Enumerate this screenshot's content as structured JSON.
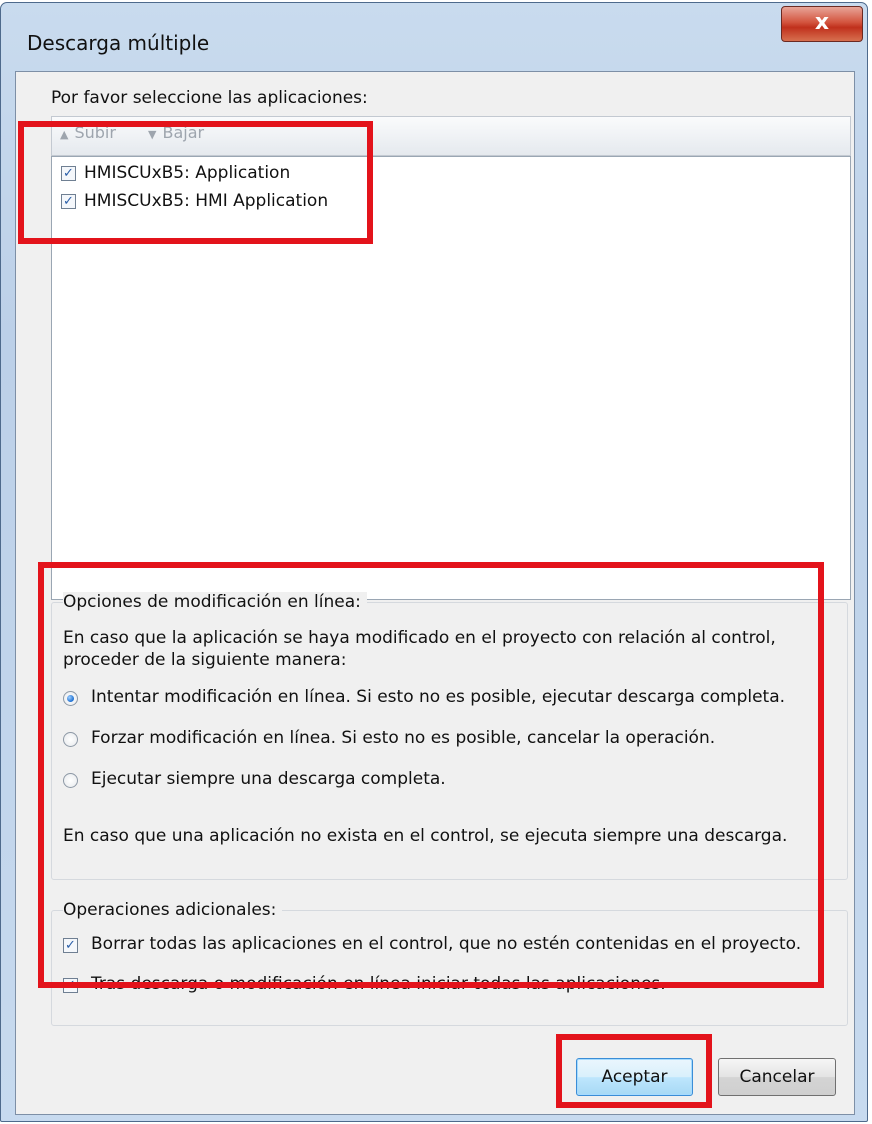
{
  "window": {
    "title": "Descarga múltiple",
    "close_icon": "close-icon",
    "close_glyph": "x"
  },
  "apps_section": {
    "label": "Por favor seleccione las aplicaciones:",
    "toolbar": {
      "up_label": "Subir",
      "down_label": "Bajar",
      "up_icon": "arrow-up-icon",
      "down_icon": "arrow-down-icon"
    },
    "items": [
      {
        "label": "HMISCUxB5:  Application",
        "checked": true
      },
      {
        "label": "HMISCUxB5:  HMI Application",
        "checked": true
      }
    ]
  },
  "online_options": {
    "legend": "Opciones de modificación en línea:",
    "description_line1": "En caso que la aplicación se haya modificado en el proyecto con relación al control,",
    "description_line2": "proceder de la siguiente manera:",
    "options": [
      {
        "label": "Intentar modificación en línea. Si esto no es posible, ejecutar descarga completa.",
        "selected": true
      },
      {
        "label": "Forzar modificación en línea. Si esto no es posible, cancelar la operación.",
        "selected": false
      },
      {
        "label": "Ejecutar siempre una descarga completa.",
        "selected": false
      }
    ],
    "note": "En caso que una aplicación no exista en el control, se ejecuta siempre una descarga."
  },
  "additional_ops": {
    "legend": "Operaciones adicionales:",
    "items": [
      {
        "label": "Borrar todas las aplicaciones en el control, que no estén contenidas en el proyecto.",
        "checked": true
      },
      {
        "label": "Tras descarga o modificación en línea iniciar todas las aplicaciones.",
        "checked": true
      }
    ]
  },
  "buttons": {
    "accept": "Aceptar",
    "cancel": "Cancelar"
  },
  "check_glyph": "✓",
  "colors": {
    "highlight": "#e3131b",
    "close_button": "#c7412a",
    "default_button_border": "#3b8dd6"
  }
}
